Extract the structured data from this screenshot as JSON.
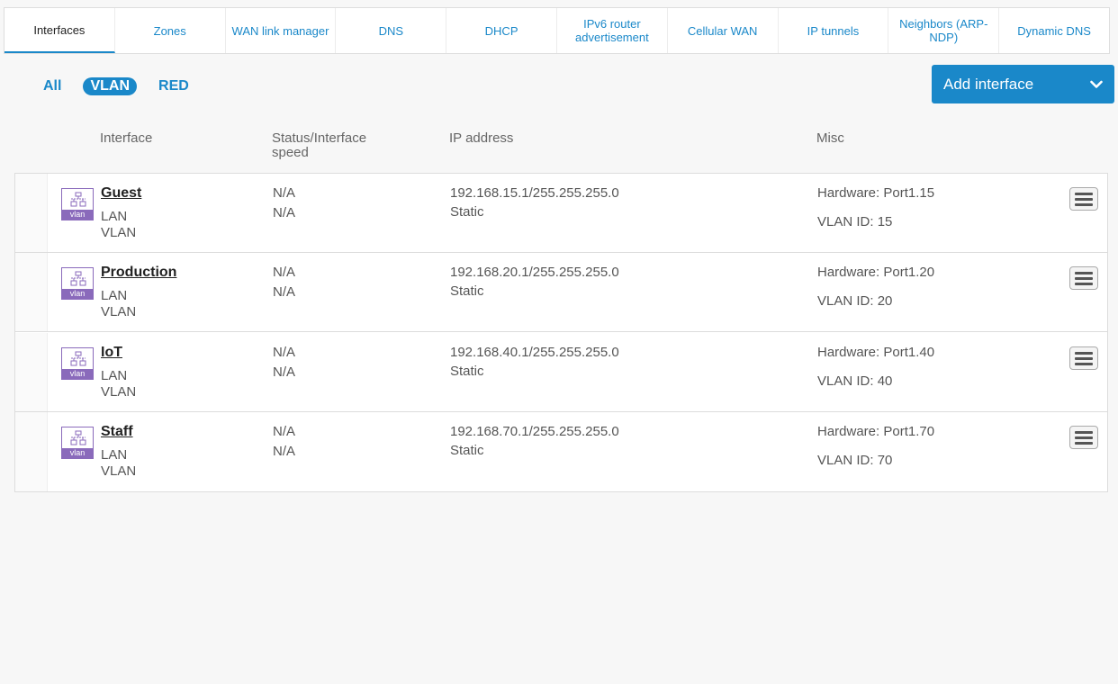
{
  "tabs": [
    {
      "label": "Interfaces"
    },
    {
      "label": "Zones"
    },
    {
      "label": "WAN link manager"
    },
    {
      "label": "DNS"
    },
    {
      "label": "DHCP"
    },
    {
      "label": "IPv6 router advertisement"
    },
    {
      "label": "Cellular WAN"
    },
    {
      "label": "IP tunnels"
    },
    {
      "label": "Neighbors (ARP-NDP)"
    },
    {
      "label": "Dynamic DNS"
    }
  ],
  "active_tab": "Interfaces",
  "filters": [
    {
      "label": "All"
    },
    {
      "label": "VLAN"
    },
    {
      "label": "RED"
    }
  ],
  "active_filter": "VLAN",
  "add_button": {
    "label": "Add interface",
    "icon": "chevron-down-icon"
  },
  "columns": {
    "interface": "Interface",
    "status": "Status/Interface speed",
    "ip": "IP address",
    "misc": "Misc"
  },
  "colors": {
    "accent": "#1a88c9",
    "vlan_icon": "#8a6abb"
  },
  "rows": [
    {
      "name": "Guest",
      "zone": "LAN",
      "type": "VLAN",
      "status": "N/A",
      "speed": "N/A",
      "ip": "192.168.15.1/255.255.255.0",
      "mode": "Static",
      "hardware_label": "Hardware:",
      "hardware": "Port1.15",
      "vlan_id_label": "VLAN ID:",
      "vlan_id": "15",
      "icon_label": "vlan"
    },
    {
      "name": "Production",
      "zone": "LAN",
      "type": "VLAN",
      "status": "N/A",
      "speed": "N/A",
      "ip": "192.168.20.1/255.255.255.0",
      "mode": "Static",
      "hardware_label": "Hardware:",
      "hardware": "Port1.20",
      "vlan_id_label": "VLAN ID:",
      "vlan_id": "20",
      "icon_label": "vlan"
    },
    {
      "name": "IoT",
      "zone": "LAN",
      "type": "VLAN",
      "status": "N/A",
      "speed": "N/A",
      "ip": "192.168.40.1/255.255.255.0",
      "mode": "Static",
      "hardware_label": "Hardware:",
      "hardware": "Port1.40",
      "vlan_id_label": "VLAN ID:",
      "vlan_id": "40",
      "icon_label": "vlan"
    },
    {
      "name": "Staff",
      "zone": "LAN",
      "type": "VLAN",
      "status": "N/A",
      "speed": "N/A",
      "ip": "192.168.70.1/255.255.255.0",
      "mode": "Static",
      "hardware_label": "Hardware:",
      "hardware": "Port1.70",
      "vlan_id_label": "VLAN ID:",
      "vlan_id": "70",
      "icon_label": "vlan"
    }
  ]
}
